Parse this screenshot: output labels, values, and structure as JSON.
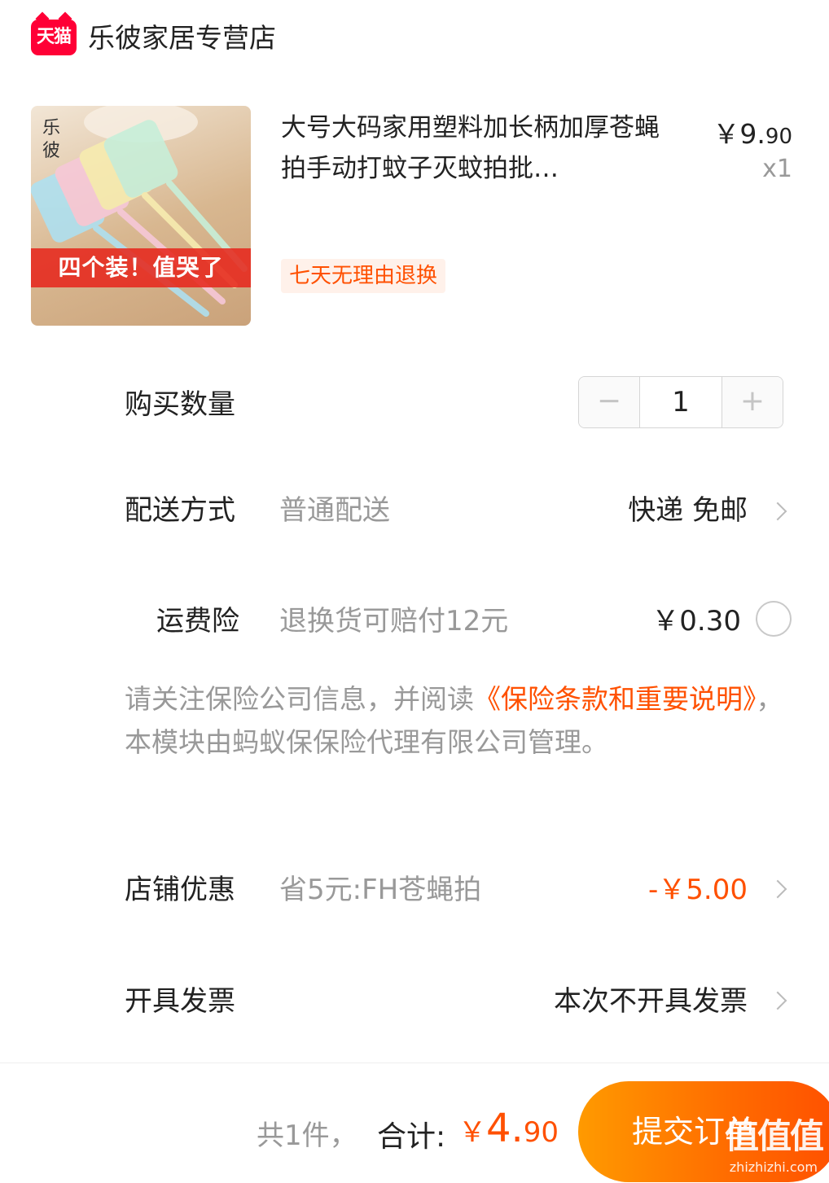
{
  "store": {
    "badge": "天猫",
    "name": "乐彼家居专营店"
  },
  "product": {
    "thumb_brand": "乐彼",
    "thumb_banner": "四个装！值哭了",
    "title": "大号大码家用塑料加长柄加厚苍蝇拍手动打蚊子灭蚊拍批…",
    "price_symbol": "￥",
    "price_int": "9.",
    "price_dec": "90",
    "quantity": "x1",
    "return_tag": "七天无理由退换"
  },
  "purchase_qty": {
    "label": "购买数量",
    "minus": "−",
    "value": "1",
    "plus": "+"
  },
  "delivery": {
    "label": "配送方式",
    "sub": "普通配送",
    "value": "快递 免邮"
  },
  "shipping_insurance": {
    "label": "运费险",
    "sub": "退换货可赔付12元",
    "value": "￥0.30",
    "selected": false
  },
  "notice": {
    "part1": "请关注保险公司信息，并阅读",
    "link": "《保险条款和重要说明》",
    "part2": "，本模块由蚂蚁保保险代理有限公司管理。"
  },
  "store_discount": {
    "label": "店铺优惠",
    "sub": "省5元:FH苍蝇拍",
    "value": "-￥5.00"
  },
  "invoice": {
    "label": "开具发票",
    "value": "本次不开具发票"
  },
  "bottom": {
    "count": "共1件，",
    "total_label": "合计:",
    "total_symbol": "￥",
    "total_int": "4.",
    "total_dec": "90",
    "submit": "提交订单",
    "watermark": "值值值",
    "watermark_url": "zhizhizhi.com"
  },
  "colors": {
    "accent": "#ff5000",
    "tmall_red": "#ff0036",
    "muted_text": "#999999",
    "submit_gradient_start": "#ff9a00",
    "submit_gradient_end": "#ff5000"
  }
}
